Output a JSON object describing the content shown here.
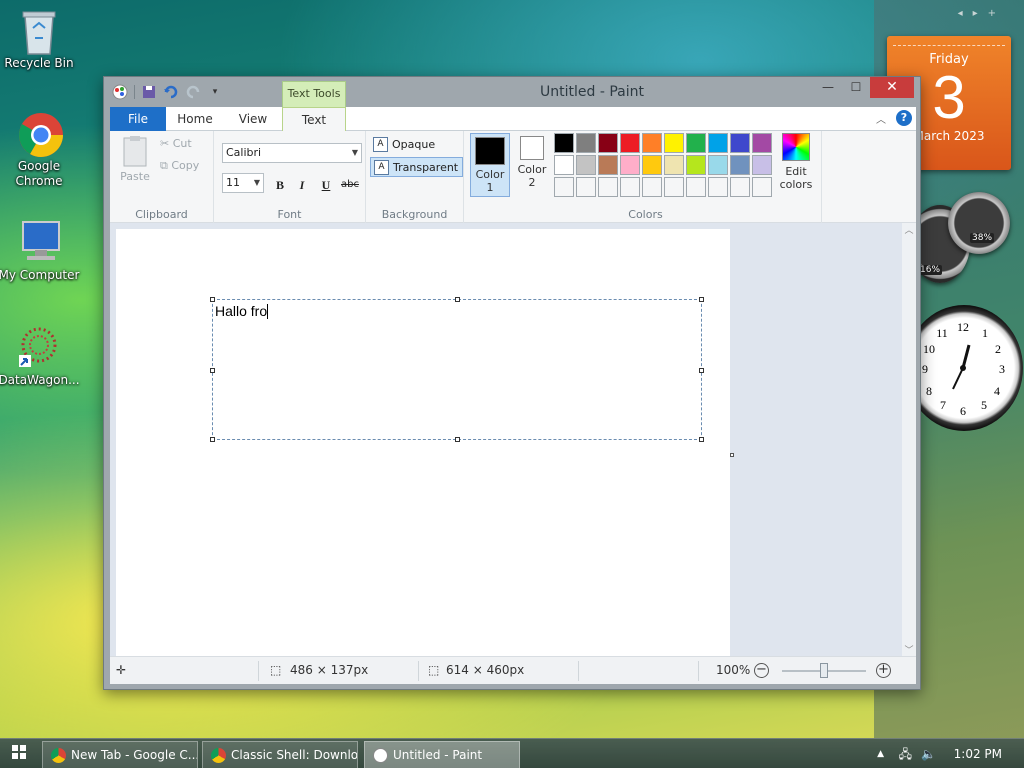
{
  "desktop": {
    "icons": [
      {
        "label": "Recycle Bin",
        "icon": "recycle-bin-icon"
      },
      {
        "label": "Google Chrome",
        "icon": "chrome-icon"
      },
      {
        "label": "My Computer",
        "icon": "computer-icon"
      },
      {
        "label": "DataWagon...",
        "icon": "datawagon-icon"
      }
    ]
  },
  "gadgets": {
    "calendar": {
      "day": "Friday",
      "date": "3",
      "month": "March 2023"
    },
    "meters": {
      "cpu": "16%",
      "mem": "38%"
    },
    "clock": {
      "numbers": [
        "1",
        "2",
        "3",
        "4",
        "5",
        "6",
        "7",
        "8",
        "9",
        "10",
        "11",
        "12"
      ]
    }
  },
  "paint": {
    "title": "Untitled - Paint",
    "context_tab": "Text Tools",
    "tabs": {
      "file": "File",
      "home": "Home",
      "view": "View",
      "text": "Text"
    },
    "clipboard": {
      "paste": "Paste",
      "cut": "Cut",
      "copy": "Copy",
      "group": "Clipboard"
    },
    "font": {
      "family": "Calibri",
      "size": "11",
      "bold": "B",
      "italic": "I",
      "underline": "U",
      "strike": "abc",
      "group": "Font"
    },
    "background": {
      "opaque": "Opaque",
      "transparent": "Transparent",
      "group": "Background"
    },
    "colors": {
      "color1_line1": "Color",
      "color1_line2": "1",
      "color2_line1": "Color",
      "color2_line2": "2",
      "edit_line1": "Edit",
      "edit_line2": "colors",
      "group": "Colors",
      "color1": "#000000",
      "color2": "#ffffff",
      "palette": [
        "#000000",
        "#7f7f7f",
        "#880015",
        "#ed1c24",
        "#ff7f27",
        "#fff200",
        "#22b14c",
        "#00a2e8",
        "#3f48cc",
        "#a349a4",
        "#ffffff",
        "#c3c3c3",
        "#b97a57",
        "#ffaec9",
        "#ffc90e",
        "#efe4b0",
        "#b5e61d",
        "#99d9ea",
        "#7092be",
        "#c8bfe7",
        "#f5f6f7",
        "#f5f6f7",
        "#f5f6f7",
        "#f5f6f7",
        "#f5f6f7",
        "#f5f6f7",
        "#f5f6f7",
        "#f5f6f7",
        "#f5f6f7",
        "#f5f6f7"
      ]
    },
    "canvas": {
      "text": "Hallo fro"
    },
    "status": {
      "selection": "486 × 137px",
      "size": "614 × 460px",
      "zoom": "100%"
    }
  },
  "taskbar": {
    "tasks": [
      {
        "label": "New Tab - Google C...",
        "icon": "chrome-icon"
      },
      {
        "label": "Classic Shell: Downlo...",
        "icon": "chrome-icon"
      },
      {
        "label": "Untitled - Paint",
        "icon": "paint-icon"
      }
    ],
    "time": "1:02 PM"
  }
}
